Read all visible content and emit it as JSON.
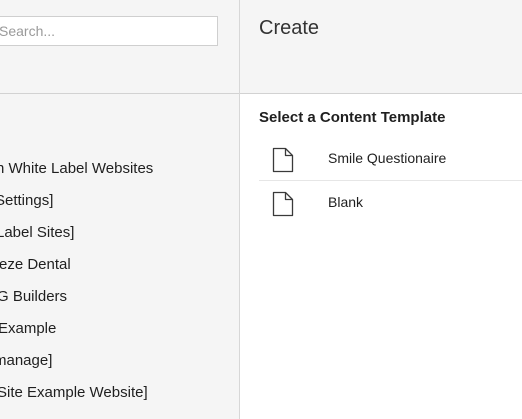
{
  "search": {
    "placeholder": "Search..."
  },
  "tree": {
    "items": [
      {
        "label": "n White Label Websites",
        "indent": 0
      },
      {
        "label": "Settings]",
        "indent": 1
      },
      {
        "label": "Label Sites]",
        "indent": 1
      },
      {
        "label": "eze Dental",
        "indent": 1
      },
      {
        "label": "G Builders",
        "indent": 1
      },
      {
        "label": "Example",
        "indent": 1
      },
      {
        "label": "manage]",
        "indent": 0
      },
      {
        "label": "Site Example Website]",
        "indent": 0
      }
    ]
  },
  "create_panel": {
    "title": "Create",
    "section_heading": "Select a Content Template",
    "templates": [
      {
        "label": "Smile Questionaire",
        "icon": "document-icon"
      },
      {
        "label": "Blank",
        "icon": "document-icon"
      }
    ]
  },
  "colors": {
    "panel_background": "#f5f5f5",
    "border": "#d2d2d2",
    "text": "#1f1f1f"
  }
}
